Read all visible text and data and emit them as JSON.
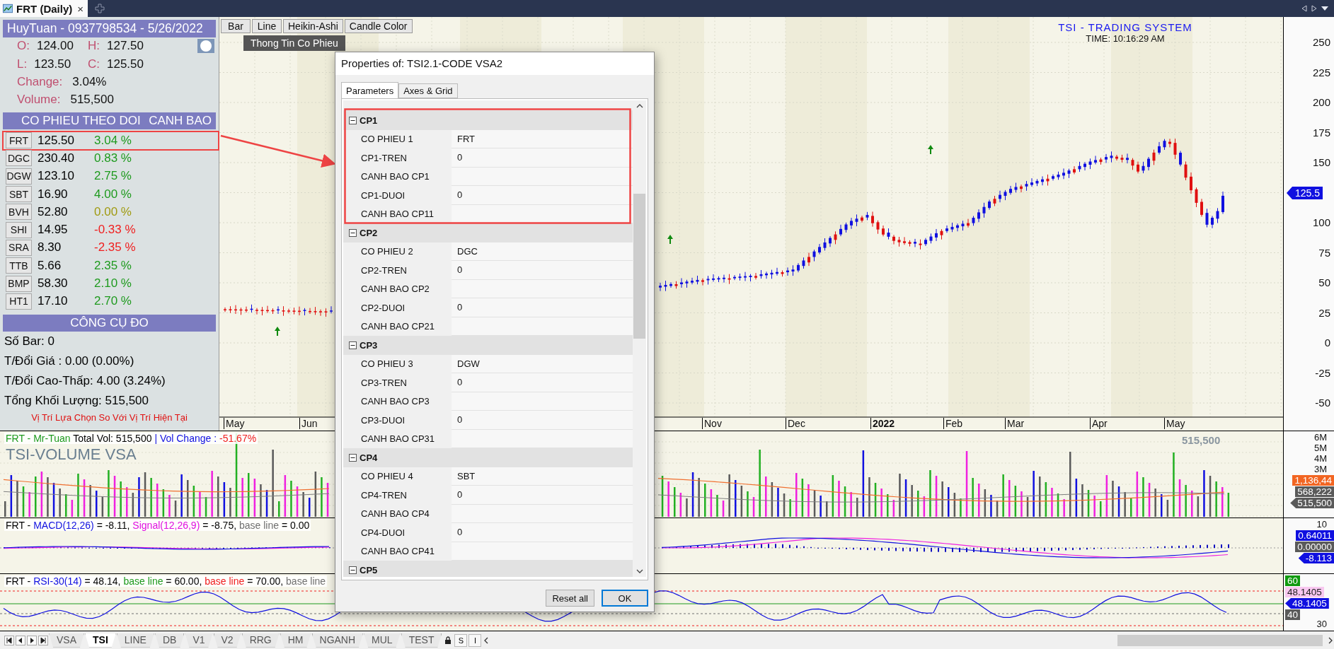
{
  "top_bar": {
    "tab_title": "FRT (Daily)",
    "close": "×"
  },
  "info_panel": {
    "header": "HuyTuan - 0937798534 - 5/26/2022",
    "ohlc": [
      {
        "label": "O:",
        "value": "124.00"
      },
      {
        "label": "H:",
        "value": "127.50"
      },
      {
        "label": "L:",
        "value": "123.50"
      },
      {
        "label": "C:",
        "value": "125.50"
      }
    ],
    "change": {
      "label": "Change:",
      "value": "3.04%"
    },
    "volume": {
      "label": "Volume:",
      "value": "515,500"
    }
  },
  "watchlist": {
    "title": "CO PHIEU THEO DOI",
    "alert_title": "CANH BAO",
    "rows": [
      {
        "symbol": "FRT",
        "price": "125.50",
        "change": "3.04 %",
        "color": "#1e9a1e"
      },
      {
        "symbol": "DGC",
        "price": "230.40",
        "change": "0.83 %",
        "color": "#1e9a1e"
      },
      {
        "symbol": "DGW",
        "price": "123.10",
        "change": "2.75 %",
        "color": "#1e9a1e"
      },
      {
        "symbol": "SBT",
        "price": "16.90",
        "change": "4.00 %",
        "color": "#1e9a1e"
      },
      {
        "symbol": "BVH",
        "price": "52.80",
        "change": "0.00 %",
        "color": "#a09a10"
      },
      {
        "symbol": "SHI",
        "price": "14.95",
        "change": "-0.33 %",
        "color": "#f01e1e"
      },
      {
        "symbol": "SRA",
        "price": "8.30",
        "change": "-2.35 %",
        "color": "#f01e1e"
      },
      {
        "symbol": "TTB",
        "price": "5.66",
        "change": "2.35 %",
        "color": "#1e9a1e"
      },
      {
        "symbol": "BMP",
        "price": "58.30",
        "change": "2.10 %",
        "color": "#1e9a1e"
      },
      {
        "symbol": "HT1",
        "price": "17.10",
        "change": "2.70 %",
        "color": "#1e9a1e"
      }
    ]
  },
  "measure_tool": {
    "title": "CÔNG CỤ ĐO",
    "lines": [
      "Số Bar: 0",
      "T/Đổi Giá : 0.00 (0.00%)",
      "T/Đổi Cao-Thấp: 4.00 (3.24%)",
      "Tổng Khối Lượng: 515,500"
    ],
    "note": "Vị Trí Lựa Chọn So Với Vị Trí Hiện Tại"
  },
  "chart": {
    "style_buttons": [
      "Bar",
      "Line",
      "Heikin-Ashi",
      "Candle Color"
    ],
    "tooltip": "Thong Tin Co Phieu",
    "title": "TSI - TRADING SYSTEM",
    "time": "TIME: 10:16:29 AM",
    "price_axis": [
      "250",
      "225",
      "200",
      "175",
      "150",
      "100",
      "75",
      "50",
      "25",
      "0",
      "-25",
      "-50"
    ],
    "last_price": "125.5",
    "months": [
      {
        "label": "May",
        "bold": false
      },
      {
        "label": "Jun",
        "bold": false
      },
      {
        "label": "Nov",
        "bold": false
      },
      {
        "label": "Dec",
        "bold": false
      },
      {
        "label": "2022",
        "bold": true
      },
      {
        "label": "Feb",
        "bold": false
      },
      {
        "label": "Mar",
        "bold": false
      },
      {
        "label": "Apr",
        "bold": false
      },
      {
        "label": "May",
        "bold": false
      }
    ]
  },
  "volume_panel": {
    "legend": [
      {
        "text": "FRT - Mr-Tuan",
        "color": "#1e9a1e"
      },
      {
        "text": " Total Vol: 515,500 ",
        "color": "#000000"
      },
      {
        "text": "| Vol Change : ",
        "color": "#1010e0"
      },
      {
        "text": "-51.67%",
        "color": "#f01e1e"
      }
    ],
    "title": "TSI-VOLUME VSA",
    "current": "515,500",
    "axis": [
      "6M",
      "5M",
      "4M",
      "3M"
    ],
    "badges": [
      {
        "text": "1,136,44",
        "color": "#f26522",
        "kind": "tag"
      },
      {
        "text": "568,222",
        "color": "#5a5a5a",
        "kind": "tag"
      },
      {
        "text": "515,500",
        "color": "#5a5a5a",
        "kind": "pointer"
      }
    ]
  },
  "macd_panel": {
    "legend": [
      {
        "text": "FRT - ",
        "color": "#000000"
      },
      {
        "text": "MACD(12,26)",
        "color": "#1010e0"
      },
      {
        "text": " = -8.11, ",
        "color": "#000000"
      },
      {
        "text": "Signal(12,26,9)",
        "color": "#e010e0"
      },
      {
        "text": " = -8.75, ",
        "color": "#000000"
      },
      {
        "text": "base line",
        "color": "#707070"
      },
      {
        "text": " = 0.00",
        "color": "#000000"
      }
    ],
    "axis": [
      "10"
    ],
    "badges": [
      {
        "text": "0.64011",
        "color": "#1010e0",
        "kind": "tag"
      },
      {
        "text": "0.00000",
        "color": "#5a5a5a",
        "kind": "tag"
      },
      {
        "text": "-8.113",
        "color": "#1010e0",
        "kind": "pointer"
      }
    ]
  },
  "rsi_panel": {
    "legend": [
      {
        "text": "FRT - ",
        "color": "#000000"
      },
      {
        "text": "RSI-30(14)",
        "color": "#1010e0"
      },
      {
        "text": " = 48.14, ",
        "color": "#000000"
      },
      {
        "text": "base line",
        "color": "#1e9a1e"
      },
      {
        "text": " = 60.00, ",
        "color": "#000000"
      },
      {
        "text": "base line",
        "color": "#f01e1e"
      },
      {
        "text": " = 70.00, ",
        "color": "#000000"
      },
      {
        "text": "base line",
        "color": "#707070"
      }
    ],
    "axis": [
      "30"
    ],
    "badges": [
      {
        "text": "60",
        "color": "#109a10",
        "kind": "tag"
      },
      {
        "text": "48.1405",
        "color": "#f8c8f0",
        "kind": "tag"
      },
      {
        "text": "48.1405",
        "color": "#1010e0",
        "kind": "pointer"
      },
      {
        "text": "40",
        "color": "#5a5a5a",
        "kind": "tag"
      }
    ]
  },
  "bottom_tabs": {
    "tabs": [
      {
        "label": "VSA",
        "selected": false
      },
      {
        "label": "TSI",
        "selected": true
      },
      {
        "label": "LINE",
        "selected": false
      },
      {
        "label": "DB",
        "selected": false
      },
      {
        "label": "V1",
        "selected": false
      },
      {
        "label": "V2",
        "selected": false
      },
      {
        "label": "RRG",
        "selected": false
      },
      {
        "label": "HM",
        "selected": false
      },
      {
        "label": "NGANH",
        "selected": false
      },
      {
        "label": "MUL",
        "selected": false
      },
      {
        "label": "TEST",
        "selected": false
      }
    ],
    "tools": [
      "S",
      "I"
    ]
  },
  "dialog": {
    "title": "Properties of: TSI2.1-CODE VSA2",
    "tabs": [
      {
        "label": "Parameters",
        "selected": true
      },
      {
        "label": "Axes & Grid",
        "selected": false
      }
    ],
    "groups": [
      {
        "name": "CP1",
        "expanded": true,
        "rows": [
          {
            "label": "CO PHIEU 1",
            "value": "FRT"
          },
          {
            "label": "CP1-TREN",
            "value": "0"
          },
          {
            "label": "CANH BAO CP1"
          },
          {
            "label": "CP1-DUOI",
            "value": "0"
          },
          {
            "label": "CANH BAO CP11"
          }
        ]
      },
      {
        "name": "CP2",
        "expanded": true,
        "rows": [
          {
            "label": "CO PHIEU 2",
            "value": "DGC"
          },
          {
            "label": "CP2-TREN",
            "value": "0"
          },
          {
            "label": "CANH BAO CP2"
          },
          {
            "label": "CP2-DUOI",
            "value": "0"
          },
          {
            "label": "CANH BAO CP21"
          }
        ]
      },
      {
        "name": "CP3",
        "expanded": true,
        "rows": [
          {
            "label": "CO PHIEU 3",
            "value": "DGW"
          },
          {
            "label": "CP3-TREN",
            "value": "0"
          },
          {
            "label": "CANH BAO CP3"
          },
          {
            "label": "CP3-DUOI",
            "value": "0"
          },
          {
            "label": "CANH BAO CP31"
          }
        ]
      },
      {
        "name": "CP4",
        "expanded": true,
        "rows": [
          {
            "label": "CO PHIEU 4",
            "value": "SBT"
          },
          {
            "label": "CP4-TREN",
            "value": "0"
          },
          {
            "label": "CANH BAO CP4"
          },
          {
            "label": "CP4-DUOI",
            "value": "0"
          },
          {
            "label": "CANH BAO CP41"
          }
        ]
      },
      {
        "name": "CP5",
        "expanded": true
      }
    ],
    "buttons": [
      {
        "label": "Reset all",
        "default": false
      },
      {
        "label": "OK",
        "default": true
      }
    ]
  }
}
